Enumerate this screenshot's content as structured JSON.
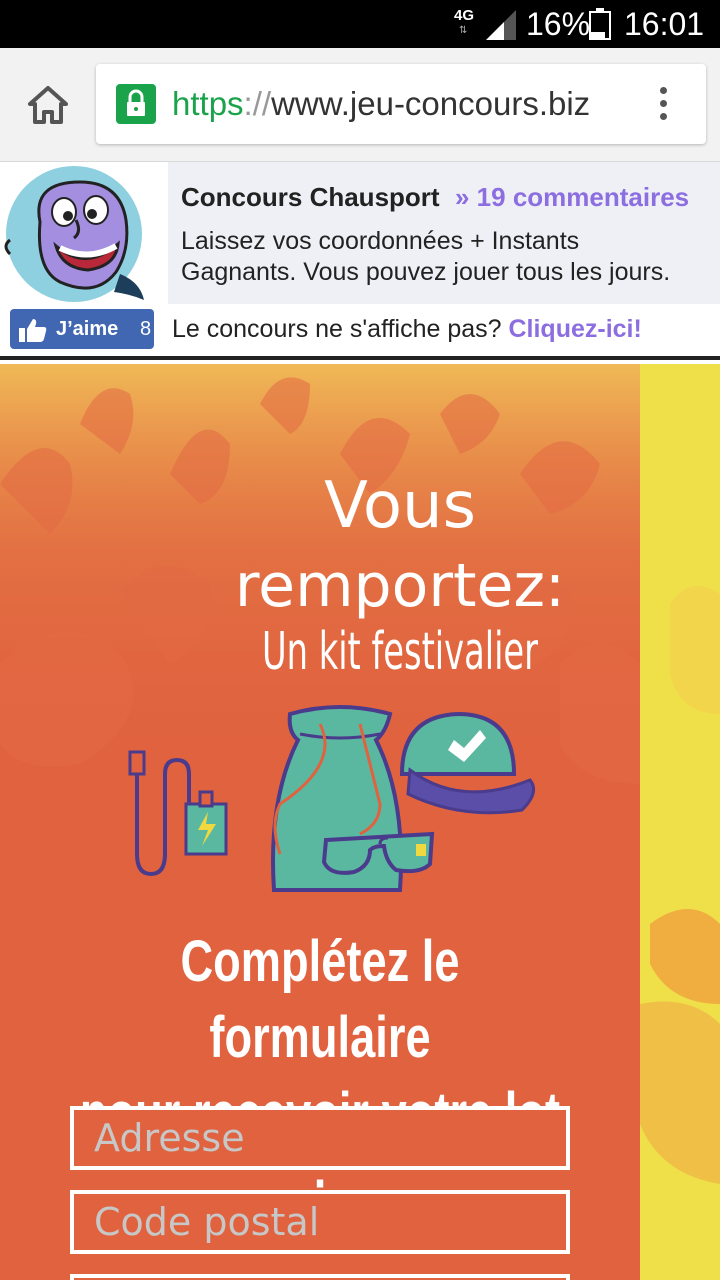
{
  "status_bar": {
    "network": "4G",
    "battery": "16%",
    "time": "16:01"
  },
  "browser": {
    "url_scheme": "https",
    "url_separator": "://",
    "url_host": "www.jeu-concours.biz"
  },
  "banner": {
    "title": "Concours Chausport",
    "comments": "» 19 commentaires",
    "description": "Laissez vos coordonnées + Instants Gagnants. Vous pouvez jouer tous les jours."
  },
  "like_bar": {
    "like_label": "J’aime",
    "like_count": "8",
    "notice_text": "Le concours ne s'affiche pas?",
    "notice_link": "Cliquez-ici!"
  },
  "promo": {
    "headline_line1": "Vous",
    "headline_line2": "remportez:",
    "prize": "Un kit festivalier",
    "form_title_line1": "Complétez le formulaire",
    "form_title_line2": "pour recevoir votre lot :",
    "fields": [
      {
        "placeholder": "Adresse"
      },
      {
        "placeholder": "Code postal"
      },
      {
        "placeholder": ""
      }
    ]
  },
  "colors": {
    "promo_orange": "#e0623f",
    "promo_yellow": "#efe04a",
    "link_purple": "#8d6ee0",
    "facebook_blue": "#4267b2",
    "secure_green": "#1aa34a"
  }
}
